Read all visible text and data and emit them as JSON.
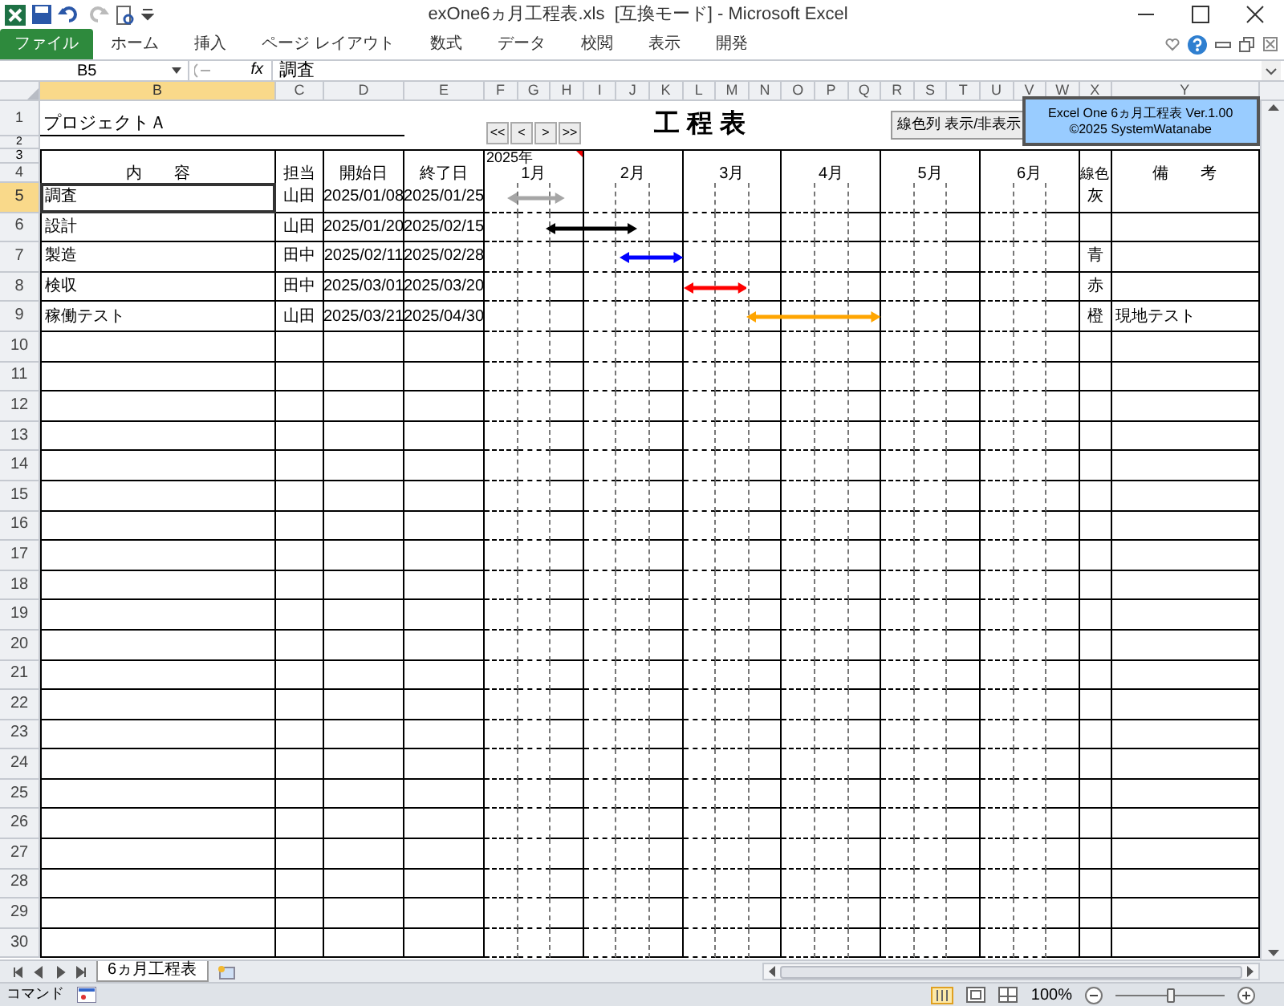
{
  "window": {
    "title": "exOne6ヵ月工程表.xls  [互換モード] - Microsoft Excel"
  },
  "ribbon_tabs": [
    {
      "label": "ファイル",
      "kind": "file"
    },
    {
      "label": "ホーム",
      "kind": "tab"
    },
    {
      "label": "挿入",
      "kind": "tab"
    },
    {
      "label": "ページ レイアウト",
      "kind": "tab"
    },
    {
      "label": "数式",
      "kind": "tab"
    },
    {
      "label": "データ",
      "kind": "tab"
    },
    {
      "label": "校閲",
      "kind": "tab"
    },
    {
      "label": "表示",
      "kind": "tab"
    },
    {
      "label": "開発",
      "kind": "tab"
    }
  ],
  "formula_bar": {
    "name_box": "B5",
    "function_label": "fx",
    "content": "調査"
  },
  "columns": [
    {
      "label": "B",
      "selected": true
    },
    {
      "label": "C",
      "selected": false
    },
    {
      "label": "D",
      "selected": false
    },
    {
      "label": "E",
      "selected": false
    },
    {
      "label": "F",
      "selected": false
    },
    {
      "label": "G",
      "selected": false
    },
    {
      "label": "H",
      "selected": false
    },
    {
      "label": "I",
      "selected": false
    },
    {
      "label": "J",
      "selected": false
    },
    {
      "label": "K",
      "selected": false
    },
    {
      "label": "L",
      "selected": false
    },
    {
      "label": "M",
      "selected": false
    },
    {
      "label": "N",
      "selected": false
    },
    {
      "label": "O",
      "selected": false
    },
    {
      "label": "P",
      "selected": false
    },
    {
      "label": "Q",
      "selected": false
    },
    {
      "label": "R",
      "selected": false
    },
    {
      "label": "S",
      "selected": false
    },
    {
      "label": "T",
      "selected": false
    },
    {
      "label": "U",
      "selected": false
    },
    {
      "label": "V",
      "selected": false
    },
    {
      "label": "W",
      "selected": false
    },
    {
      "label": "X",
      "selected": false
    },
    {
      "label": "Y",
      "selected": false
    }
  ],
  "row_headers": [
    {
      "label": "1",
      "selected": false
    },
    {
      "label": "2",
      "selected": false
    },
    {
      "label": "3",
      "selected": false
    },
    {
      "label": "4",
      "selected": false
    },
    {
      "label": "5",
      "selected": true
    },
    {
      "label": "6",
      "selected": false
    },
    {
      "label": "7",
      "selected": false
    },
    {
      "label": "8",
      "selected": false
    },
    {
      "label": "9",
      "selected": false
    },
    {
      "label": "10",
      "selected": false
    },
    {
      "label": "11",
      "selected": false
    },
    {
      "label": "12",
      "selected": false
    },
    {
      "label": "13",
      "selected": false
    },
    {
      "label": "14",
      "selected": false
    },
    {
      "label": "15",
      "selected": false
    },
    {
      "label": "16",
      "selected": false
    },
    {
      "label": "17",
      "selected": false
    },
    {
      "label": "18",
      "selected": false
    },
    {
      "label": "19",
      "selected": false
    },
    {
      "label": "20",
      "selected": false
    },
    {
      "label": "21",
      "selected": false
    },
    {
      "label": "22",
      "selected": false
    },
    {
      "label": "23",
      "selected": false
    },
    {
      "label": "24",
      "selected": false
    },
    {
      "label": "25",
      "selected": false
    },
    {
      "label": "26",
      "selected": false
    },
    {
      "label": "27",
      "selected": false
    },
    {
      "label": "28",
      "selected": false
    },
    {
      "label": "29",
      "selected": false
    },
    {
      "label": "30",
      "selected": false
    }
  ],
  "sheet": {
    "project": "プロジェクトＡ",
    "nav_buttons": [
      "<<",
      "<",
      ">",
      ">>"
    ],
    "title": "工 程 表",
    "toggle_button": "線色列 表示/非表示",
    "info": [
      "Excel One 6ヵ月工程表 Ver.1.00",
      "©2025 SystemWatanabe"
    ],
    "headers": {
      "content": "内　　容",
      "owner": "担当",
      "start": "開始日",
      "end": "終了日",
      "line_color": "線色",
      "remarks": "備　　考"
    },
    "year": "2025年",
    "months": [
      "1月",
      "2月",
      "3月",
      "4月",
      "5月",
      "6月"
    ],
    "tasks": [
      {
        "name": "調査",
        "owner": "山田",
        "start": "2025/01/08",
        "end": "2025/01/25",
        "color": "#a6a6a6",
        "color_label": "灰",
        "selected": true
      },
      {
        "name": "設計",
        "owner": "山田",
        "start": "2025/01/20",
        "end": "2025/02/15",
        "color": "#000000",
        "selected": false
      },
      {
        "name": "製造",
        "owner": "田中",
        "start": "2025/02/11",
        "end": "2025/02/28",
        "color": "#0000ff",
        "color_label": "青",
        "selected": false
      },
      {
        "name": "検収",
        "owner": "田中",
        "start": "2025/03/01",
        "end": "2025/03/20",
        "color": "#ff0000",
        "color_label": "赤",
        "selected": false
      },
      {
        "name": "稼働テスト",
        "owner": "山田",
        "start": "2025/03/21",
        "end": "2025/04/30",
        "color": "#ffa500",
        "color_label": "橙",
        "remarks": "現地テスト",
        "selected": false
      }
    ]
  },
  "sheet_tabs": [
    {
      "label": "6ヵ月工程表",
      "selected": true
    }
  ],
  "status_bar": {
    "mode": "コマンド",
    "zoom": "100%",
    "zoom_slider": {
      "level": 0.5
    }
  }
}
